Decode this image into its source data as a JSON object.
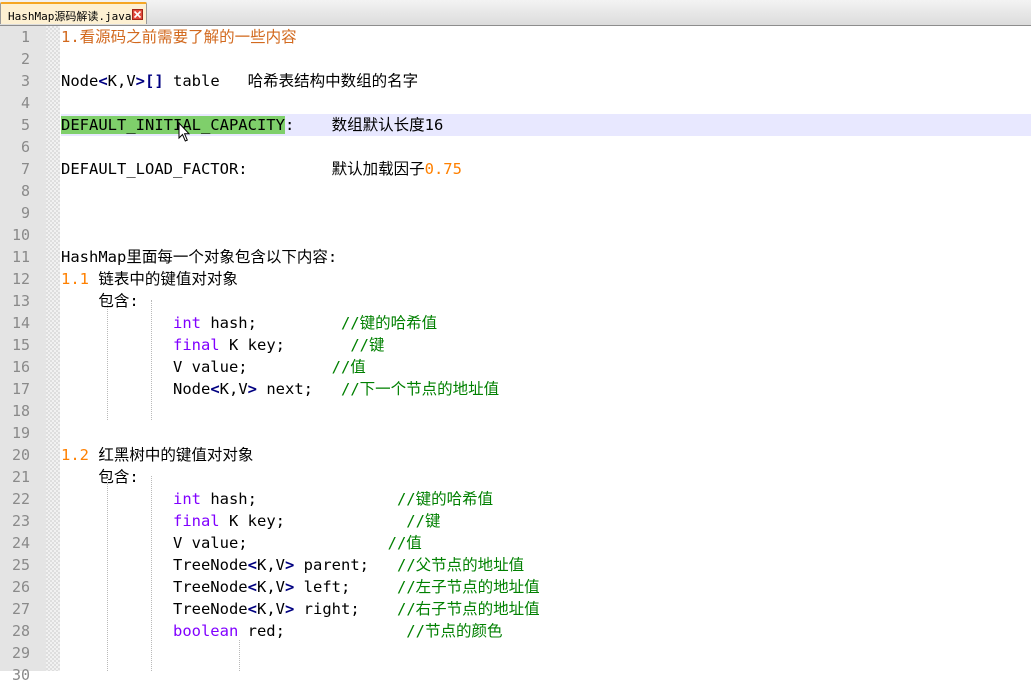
{
  "tab": {
    "title": "HashMap源码解读.java"
  },
  "lines": [
    {
      "n": "1",
      "segs": [
        {
          "t": "1.看源码之前需要了解的一些内容",
          "c": "cm"
        }
      ]
    },
    {
      "n": "2",
      "segs": []
    },
    {
      "n": "3",
      "segs": [
        {
          "t": "Node"
        },
        {
          "t": "<",
          "c": "op"
        },
        {
          "t": "K,V"
        },
        {
          "t": ">[]",
          "c": "op"
        },
        {
          "t": " table   哈希表结构中数组的名字"
        }
      ]
    },
    {
      "n": "4",
      "segs": []
    },
    {
      "n": "5",
      "current": true,
      "segs": [
        {
          "t": "DEFAULT_INITIAL_CAPACITY",
          "c": "sel"
        },
        {
          "t": ":    数组默认长度16"
        }
      ]
    },
    {
      "n": "6",
      "segs": []
    },
    {
      "n": "7",
      "segs": [
        {
          "t": "DEFAULT_LOAD_FACTOR:         默认加载因子"
        },
        {
          "t": "0.75",
          "c": "num"
        }
      ]
    },
    {
      "n": "8",
      "segs": []
    },
    {
      "n": "9",
      "segs": []
    },
    {
      "n": "10",
      "segs": []
    },
    {
      "n": "11",
      "segs": [
        {
          "t": "HashMap里面每一个对象包含以下内容:"
        }
      ]
    },
    {
      "n": "12",
      "segs": [
        {
          "t": "1.1",
          "c": "num"
        },
        {
          "t": " 链表中的键值对对象"
        }
      ]
    },
    {
      "n": "13",
      "segs": [
        {
          "t": "    包含:"
        }
      ]
    },
    {
      "n": "14",
      "segs": [
        {
          "t": "            "
        },
        {
          "t": "int",
          "c": "kw"
        },
        {
          "t": " hash;         "
        },
        {
          "t": "//键的哈希值",
          "c": "cmt"
        }
      ]
    },
    {
      "n": "15",
      "segs": [
        {
          "t": "            "
        },
        {
          "t": "final",
          "c": "kw"
        },
        {
          "t": " K key;       "
        },
        {
          "t": "//键",
          "c": "cmt"
        }
      ]
    },
    {
      "n": "16",
      "segs": [
        {
          "t": "            V value;         "
        },
        {
          "t": "//值",
          "c": "cmt"
        }
      ]
    },
    {
      "n": "17",
      "segs": [
        {
          "t": "            Node"
        },
        {
          "t": "<",
          "c": "op"
        },
        {
          "t": "K,V"
        },
        {
          "t": ">",
          "c": "op"
        },
        {
          "t": " next;   "
        },
        {
          "t": "//下一个节点的地址值",
          "c": "cmt"
        }
      ]
    },
    {
      "n": "18",
      "segs": []
    },
    {
      "n": "19",
      "segs": []
    },
    {
      "n": "20",
      "segs": [
        {
          "t": "1.2",
          "c": "num"
        },
        {
          "t": " 红黑树中的键值对对象"
        }
      ]
    },
    {
      "n": "21",
      "segs": [
        {
          "t": "    包含:"
        }
      ]
    },
    {
      "n": "22",
      "segs": [
        {
          "t": "            "
        },
        {
          "t": "int",
          "c": "kw"
        },
        {
          "t": " hash;               "
        },
        {
          "t": "//键的哈希值",
          "c": "cmt"
        }
      ]
    },
    {
      "n": "23",
      "segs": [
        {
          "t": "            "
        },
        {
          "t": "final",
          "c": "kw"
        },
        {
          "t": " K key;             "
        },
        {
          "t": "//键",
          "c": "cmt"
        }
      ]
    },
    {
      "n": "24",
      "segs": [
        {
          "t": "            V value;               "
        },
        {
          "t": "//值",
          "c": "cmt"
        }
      ]
    },
    {
      "n": "25",
      "segs": [
        {
          "t": "            TreeNode"
        },
        {
          "t": "<",
          "c": "op"
        },
        {
          "t": "K,V"
        },
        {
          "t": ">",
          "c": "op"
        },
        {
          "t": " parent;   "
        },
        {
          "t": "//父节点的地址值",
          "c": "cmt"
        }
      ]
    },
    {
      "n": "26",
      "segs": [
        {
          "t": "            TreeNode"
        },
        {
          "t": "<",
          "c": "op"
        },
        {
          "t": "K,V"
        },
        {
          "t": ">",
          "c": "op"
        },
        {
          "t": " left;     "
        },
        {
          "t": "//左子节点的地址值",
          "c": "cmt"
        }
      ]
    },
    {
      "n": "27",
      "segs": [
        {
          "t": "            TreeNode"
        },
        {
          "t": "<",
          "c": "op"
        },
        {
          "t": "K,V"
        },
        {
          "t": ">",
          "c": "op"
        },
        {
          "t": " right;    "
        },
        {
          "t": "//右子节点的地址值",
          "c": "cmt"
        }
      ]
    },
    {
      "n": "28",
      "segs": [
        {
          "t": "            "
        },
        {
          "t": "boolean",
          "c": "kw"
        },
        {
          "t": " red;             "
        },
        {
          "t": "//节点的颜色",
          "c": "cmt"
        }
      ]
    },
    {
      "n": "29",
      "segs": []
    },
    {
      "n": "30",
      "segs": []
    }
  ]
}
